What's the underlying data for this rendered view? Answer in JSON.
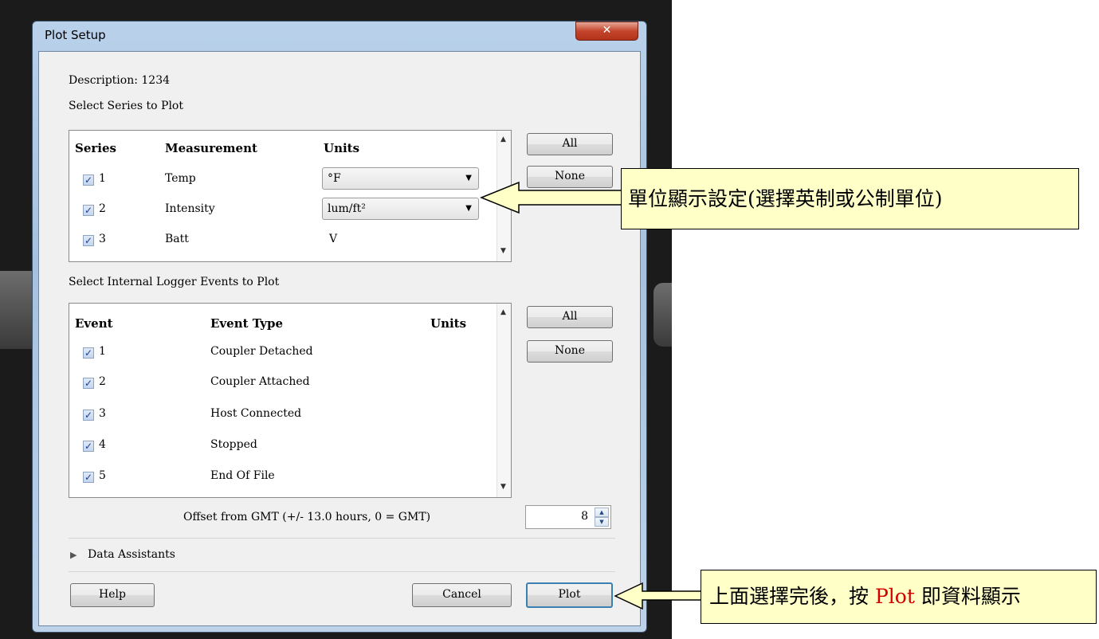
{
  "window": {
    "title": "Plot Setup",
    "close_glyph": "✕"
  },
  "description": "Description: 1234",
  "series_section": {
    "label": "Select Series to Plot",
    "headers": {
      "series": "Series",
      "measurement": "Measurement",
      "units": "Units"
    },
    "rows": [
      {
        "num": "1",
        "measurement": "Temp",
        "units": "°F",
        "checked": true,
        "dropdown": true
      },
      {
        "num": "2",
        "measurement": "Intensity",
        "units": "lum/ft²",
        "checked": true,
        "dropdown": true
      },
      {
        "num": "3",
        "measurement": "Batt",
        "units": "V",
        "checked": true,
        "dropdown": false
      }
    ],
    "all_button": "All",
    "none_button": "None"
  },
  "events_section": {
    "label": "Select Internal Logger Events to Plot",
    "headers": {
      "event": "Event",
      "event_type": "Event Type",
      "units": "Units"
    },
    "rows": [
      {
        "num": "1",
        "type": "Coupler Detached",
        "checked": true
      },
      {
        "num": "2",
        "type": "Coupler Attached",
        "checked": true
      },
      {
        "num": "3",
        "type": "Host Connected",
        "checked": true
      },
      {
        "num": "4",
        "type": "Stopped",
        "checked": true
      },
      {
        "num": "5",
        "type": "End Of File",
        "checked": true
      }
    ],
    "all_button": "All",
    "none_button": "None"
  },
  "offset": {
    "label": "Offset from GMT (+/- 13.0 hours, 0 = GMT)",
    "value": "8"
  },
  "data_assistants": "Data Assistants",
  "buttons": {
    "help": "Help",
    "cancel": "Cancel",
    "plot": "Plot"
  },
  "callouts": {
    "units": "單位顯示設定(選擇英制或公制單位)",
    "plot_prefix": "上面選擇完後，按 ",
    "plot_highlight": "Plot",
    "plot_suffix": " 即資料顯示",
    "highlight_color": "#d40000",
    "fill_color": "#ffffc8"
  }
}
